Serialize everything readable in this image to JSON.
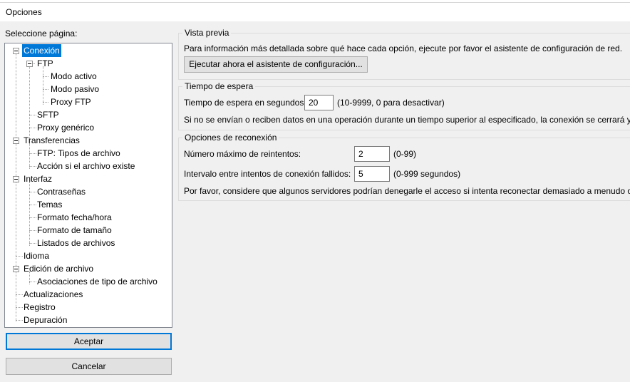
{
  "window": {
    "title": "Opciones"
  },
  "select_page_label": "Seleccione página:",
  "tree": [
    {
      "label": "Conexión",
      "selected": true
    },
    {
      "label": "FTP"
    },
    {
      "label": "Modo activo"
    },
    {
      "label": "Modo pasivo"
    },
    {
      "label": "Proxy FTP"
    },
    {
      "label": "SFTP"
    },
    {
      "label": "Proxy genérico"
    },
    {
      "label": "Transferencias"
    },
    {
      "label": "FTP: Tipos de archivo"
    },
    {
      "label": "Acción si el archivo existe"
    },
    {
      "label": "Interfaz"
    },
    {
      "label": "Contraseñas"
    },
    {
      "label": "Temas"
    },
    {
      "label": "Formato fecha/hora"
    },
    {
      "label": "Formato de tamaño"
    },
    {
      "label": "Listados de archivos"
    },
    {
      "label": "Idioma"
    },
    {
      "label": "Edición de archivo"
    },
    {
      "label": "Asociaciones de tipo de archivo"
    },
    {
      "label": "Actualizaciones"
    },
    {
      "label": "Registro"
    },
    {
      "label": "Depuración"
    }
  ],
  "buttons": {
    "accept": "Aceptar",
    "cancel": "Cancelar"
  },
  "preview": {
    "title": "Vista previa",
    "description": "Para información más detallada sobre qué hace cada opción, ejecute por favor el asistente de configuración de red.",
    "wizard_button": "Ejecutar ahora el asistente de configuración..."
  },
  "timeout": {
    "title": "Tiempo de espera",
    "label": "Tiempo de espera en segundos:",
    "value": "20",
    "hint": "(10-9999, 0 para desactivar)",
    "note": "Si no se envían o reciben datos en una operación durante un tiempo superior al especificado, la conexión se cerrará y Fi"
  },
  "reconnect": {
    "title": "Opciones de reconexión",
    "retries_label": "Número máximo de reintentos:",
    "retries_value": "2",
    "retries_hint": "(0-99)",
    "interval_label": "Intervalo entre intentos de conexión fallidos:",
    "interval_value": "5",
    "interval_hint": "(0-999 segundos)",
    "note": "Por favor, considere que algunos servidores podrían denegarle el acceso si intenta reconectar demasiado a menudo o a"
  }
}
